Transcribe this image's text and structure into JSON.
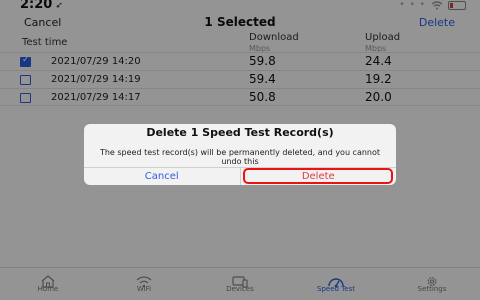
{
  "status": {
    "time": "2:20",
    "location_glyph": "➶",
    "signal": "• • •"
  },
  "navbar": {
    "cancel": "Cancel",
    "title": "1 Selected",
    "delete": "Delete"
  },
  "table": {
    "headers": {
      "time": "Test time",
      "download": "Download",
      "download_unit": "Mbps",
      "upload": "Upload",
      "upload_unit": "Mbps"
    },
    "rows": [
      {
        "time": "2021/07/29 14:20",
        "download": "59.8",
        "upload": "24.4",
        "checked": true
      },
      {
        "time": "2021/07/29 14:19",
        "download": "59.4",
        "upload": "19.2",
        "checked": false
      },
      {
        "time": "2021/07/29 14:17",
        "download": "50.8",
        "upload": "20.0",
        "checked": false
      }
    ]
  },
  "dialog": {
    "title": "Delete 1 Speed Test Record(s)",
    "message": "The speed test record(s) will be permanently deleted, and you cannot undo this",
    "cancel": "Cancel",
    "delete": "Delete"
  },
  "tabs": [
    {
      "label": "Home",
      "icon": "home-icon",
      "active": false
    },
    {
      "label": "WiFi",
      "icon": "wifi-icon",
      "active": false
    },
    {
      "label": "Devices",
      "icon": "devices-icon",
      "active": false
    },
    {
      "label": "Speed Test",
      "icon": "speedometer-icon",
      "active": true
    },
    {
      "label": "Settings",
      "icon": "gear-icon",
      "active": false
    }
  ],
  "colors": {
    "accent": "#2d5fe3",
    "destructive": "#e03a3a",
    "highlight_ring": "#ee1111"
  }
}
